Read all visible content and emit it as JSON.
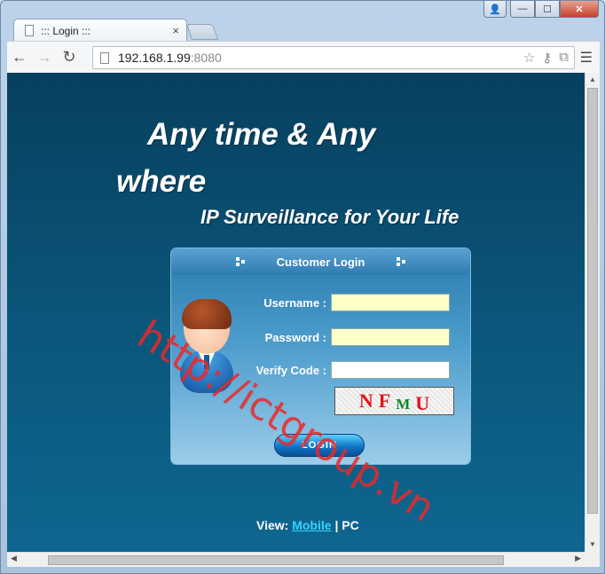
{
  "browser": {
    "tab_title": "::: Login :::",
    "tab_close": "×",
    "url_host": "192.168.1.99",
    "url_port": ":8080",
    "window_controls": {
      "minimize": "—",
      "maximize": "☐",
      "close": "✕"
    }
  },
  "page": {
    "headline_line1": "Any time & Any",
    "headline_line2": "where",
    "subheadline": "IP Surveillance for Your Life",
    "panel_title": "Customer Login",
    "username_label": "Username :",
    "password_label": "Password :",
    "verify_label": "Verify Code :",
    "username_value": "",
    "password_value": "",
    "verify_value": "",
    "captcha_chars": [
      {
        "char": "N",
        "color": "#e0141a"
      },
      {
        "char": "F",
        "color": "#e0141a"
      },
      {
        "char": "M",
        "color": "#0a8a2a"
      },
      {
        "char": "U",
        "color": "#e0141a"
      }
    ],
    "login_button": "LOGIN",
    "view_prefix": "View:",
    "view_mobile": "Mobile",
    "view_separator": "|",
    "view_pc": "PC"
  },
  "watermark": "http://ictgroup.vn"
}
